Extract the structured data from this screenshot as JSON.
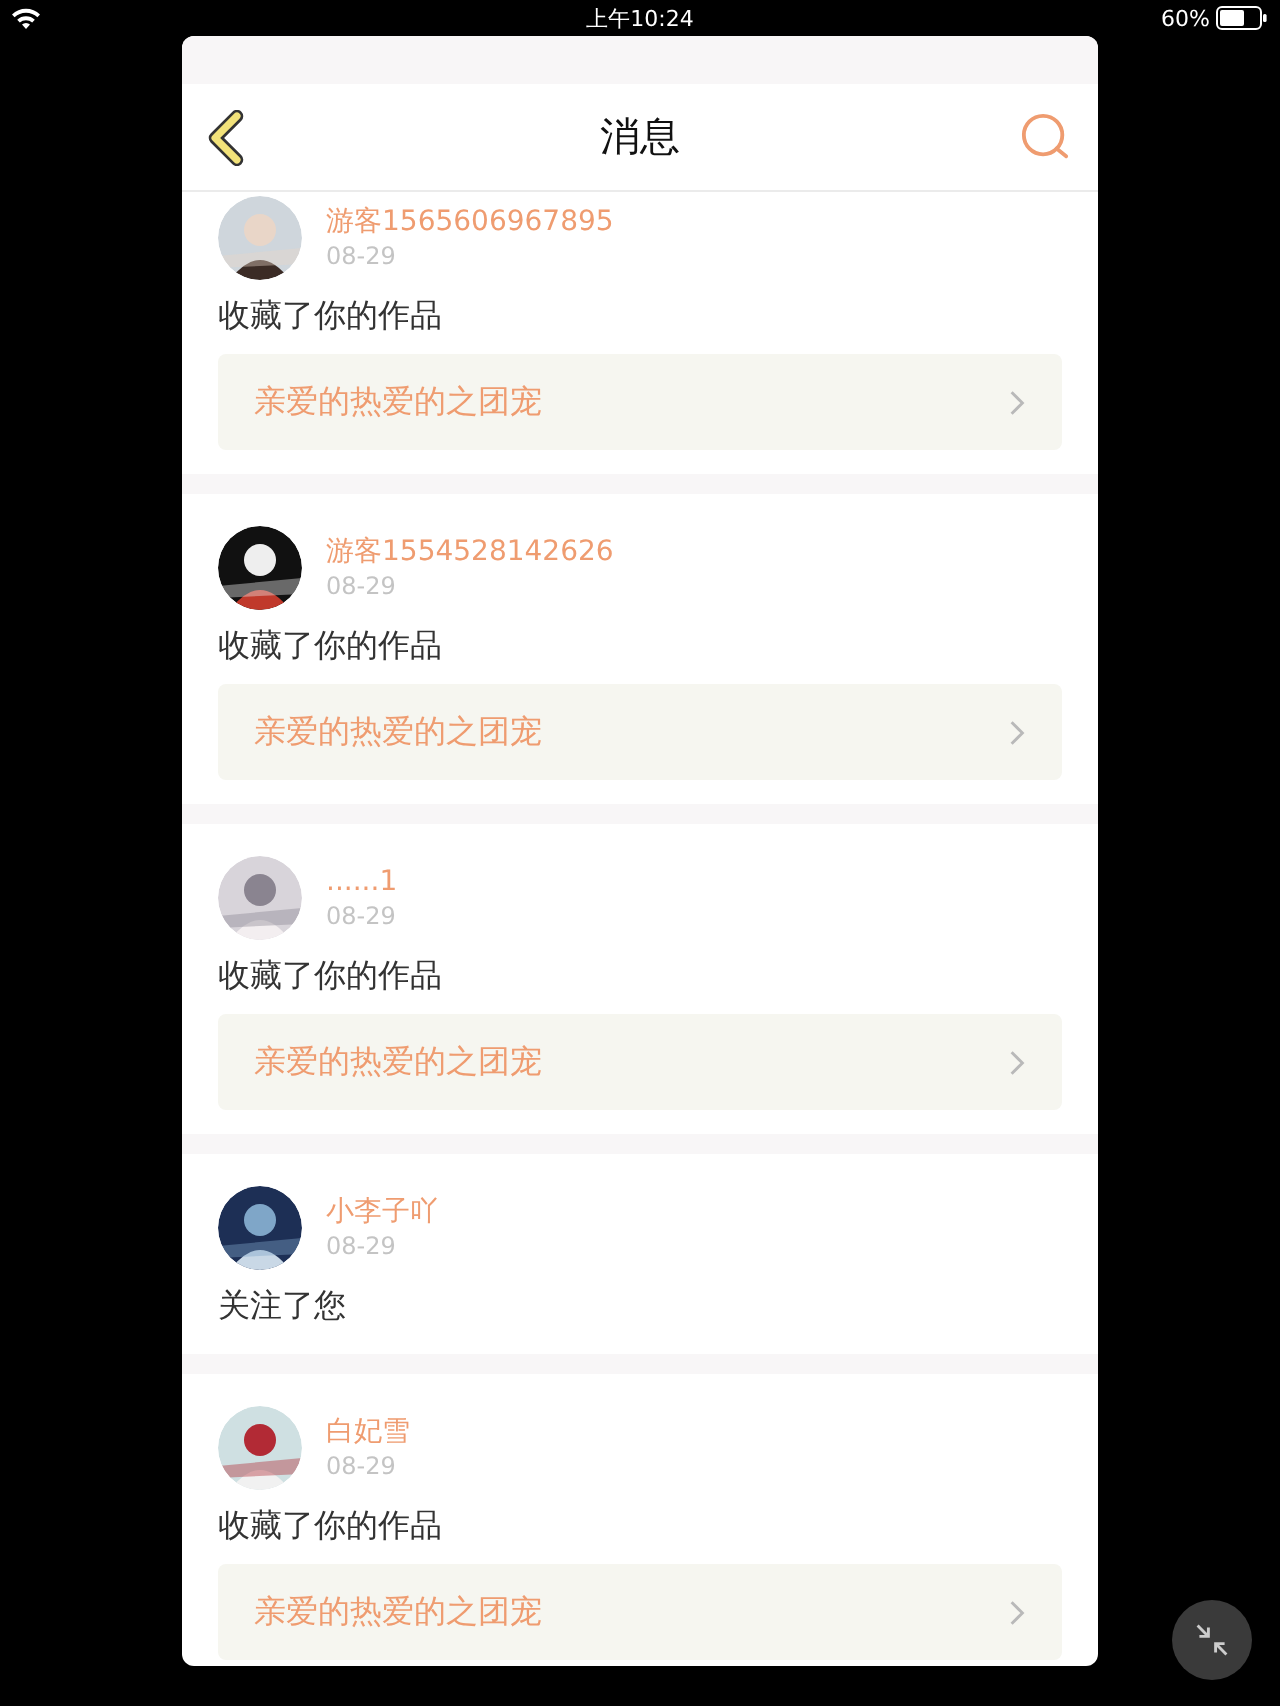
{
  "status_bar": {
    "time": "上午10:24",
    "battery": "60%"
  },
  "header": {
    "title": "消息"
  },
  "messages": [
    {
      "kind": "work",
      "user": "游客1565606967895",
      "date": "08-29",
      "action": "收藏了你的作品",
      "work_title": "亲爱的热爱的之团宠"
    },
    {
      "kind": "work",
      "user": "游客1554528142626",
      "date": "08-29",
      "action": "收藏了你的作品",
      "work_title": "亲爱的热爱的之团宠"
    },
    {
      "kind": "work",
      "user": "......1",
      "date": "08-29",
      "action": "收藏了你的作品",
      "work_title": "亲爱的热爱的之团宠"
    },
    {
      "kind": "follow",
      "user": "小李子吖",
      "date": "08-29",
      "action": "关注了您"
    },
    {
      "kind": "work",
      "user": "白妃雪",
      "date": "08-29",
      "action": "收藏了你的作品",
      "work_title": "亲爱的热爱的之团宠"
    }
  ]
}
